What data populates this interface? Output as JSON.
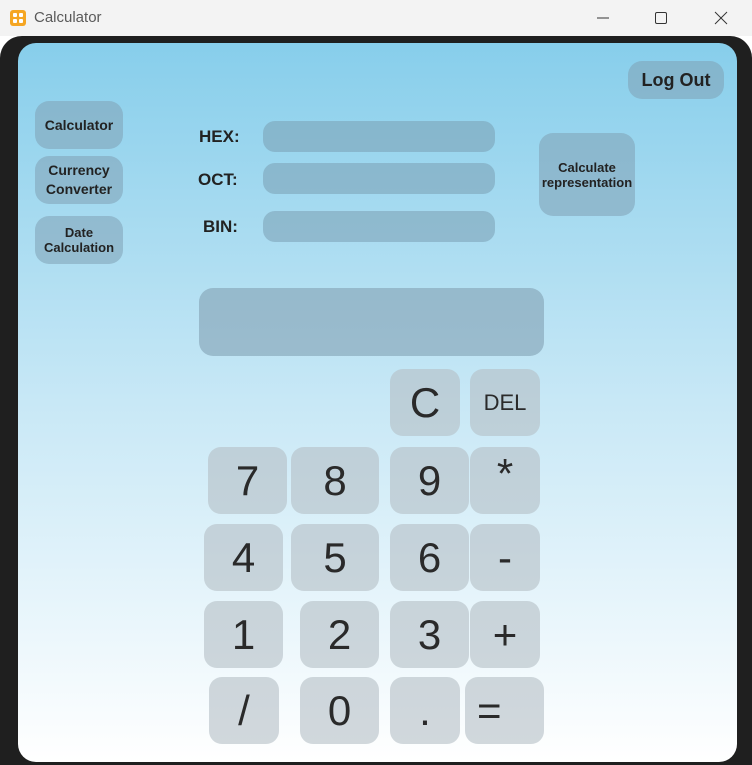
{
  "window": {
    "title": "Calculator"
  },
  "header": {
    "logout_label": "Log Out"
  },
  "sidebar": {
    "items": [
      {
        "label": "Calculator"
      },
      {
        "label": "Currency\nConverter"
      },
      {
        "label": "Date\nCalculation"
      }
    ]
  },
  "representation": {
    "hex_label": "HEX:",
    "oct_label": "OCT:",
    "bin_label": "BIN:",
    "hex_value": "",
    "oct_value": "",
    "bin_value": "",
    "calculate_label": "Calculate\nrepresentation"
  },
  "display": {
    "value": ""
  },
  "keypad": {
    "clear": "C",
    "delete": "DEL",
    "k7": "7",
    "k8": "8",
    "k9": "9",
    "mul": "*",
    "k4": "4",
    "k5": "5",
    "k6": "6",
    "sub": "-",
    "k1": "1",
    "k2": "2",
    "k3": "3",
    "add": "+",
    "div": "/",
    "k0": "0",
    "dot": ".",
    "eq": "="
  },
  "colors": {
    "background_top": "#87ceeb",
    "background_bottom": "#ffffff",
    "frame": "#1f1f1f"
  }
}
